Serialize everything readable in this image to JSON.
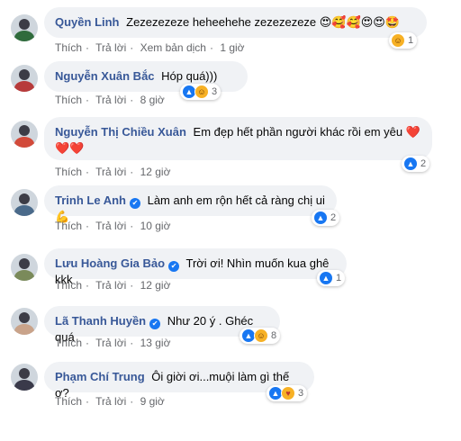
{
  "comments": [
    {
      "name": "Quyền Linh",
      "text": "Zezezezeze heheehehe zezezezeze",
      "emoji_tail": "😍🥰🥰😍😍🤩",
      "actions": {
        "like": "Thích",
        "reply": "Trả lời",
        "translate": "Xem bản dịch",
        "time": "1 giờ"
      },
      "reaction_count": "1"
    },
    {
      "name": "Nguyễn Xuân Bắc",
      "text": "Hóp quá)))",
      "actions": {
        "like": "Thích",
        "reply": "Trả lời",
        "time": "8 giờ"
      },
      "reaction_count": "3"
    },
    {
      "name": "Nguyễn Thị Chiều Xuân",
      "text": "Em đẹp hết phần người khác rồi em yêu ❤️",
      "text_line2": "❤️❤️",
      "actions": {
        "like": "Thích",
        "reply": "Trả lời",
        "time": "12 giờ"
      },
      "reaction_count": "2"
    },
    {
      "name": "Trinh Le Anh",
      "text": "Làm anh em rộn hết cả ràng chị ui💪",
      "actions": {
        "like": "Thích",
        "reply": "Trả lời",
        "time": "10 giờ"
      },
      "reaction_count": "2"
    },
    {
      "name": "Lưu Hoàng Gia Bảo",
      "text": "Trời ơi! Nhìn muốn kua ghê kkk",
      "actions": {
        "like": "Thích",
        "reply": "Trả lời",
        "time": "12 giờ"
      },
      "reaction_count": "1"
    },
    {
      "name": "Lã Thanh Huyền",
      "text": "Như 20 ý . Ghéc quá",
      "actions": {
        "like": "Thích",
        "reply": "Trả lời",
        "time": "13 giờ"
      },
      "reaction_count": "8"
    },
    {
      "name": "Phạm Chí Trung",
      "text": "Ôi giời ơi...muội làm gì thế ơ?",
      "actions": {
        "like": "Thích",
        "reply": "Trả lời",
        "time": "9 giờ"
      },
      "reaction_count": "3"
    }
  ],
  "icons": {
    "verified": "✔",
    "like": "👍",
    "haha": "😆",
    "love": "❤",
    "care": "🥰",
    "wow": "😮"
  },
  "colors": {
    "name": "#385898",
    "bubble": "#f0f2f5",
    "meta": "#65676b",
    "like": "#1877f2"
  }
}
